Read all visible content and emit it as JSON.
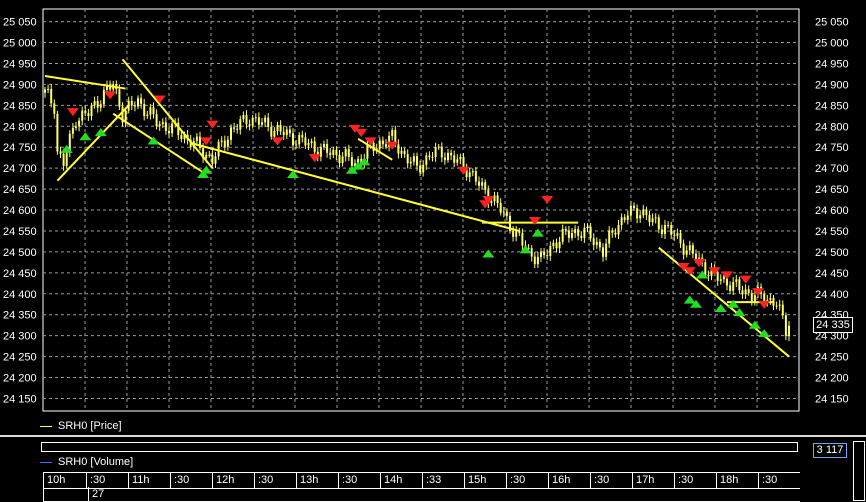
{
  "chart_data": {
    "type": "candlestick",
    "title": "",
    "price_series_name": "SRH0 [Price]",
    "volume_series_name": "SRH0 [Volume]",
    "y_ticks": [
      24150,
      24200,
      24250,
      24300,
      24350,
      24400,
      24450,
      24500,
      24550,
      24600,
      24650,
      24700,
      24750,
      24800,
      24850,
      24900,
      24950,
      25000,
      25050
    ],
    "y_tick_labels": [
      "24 150",
      "24 200",
      "24 250",
      "24 300",
      "24 350",
      "24 400",
      "24 450",
      "24 500",
      "24 550",
      "24 600",
      "24 650",
      "24 700",
      "24 750",
      "24 800",
      "24 850",
      "24 900",
      "24 950",
      "25 000",
      "25 050"
    ],
    "ylim": [
      24120,
      25080
    ],
    "grid": true,
    "last_price_label": "24 335",
    "volume_value_label": "3 117",
    "time_labels": [
      "10h",
      ":30",
      "11h",
      ":30",
      "12h",
      ":30",
      "13h",
      ":30",
      "14h",
      ":33",
      "15h",
      ":30",
      "16h",
      ":30",
      "17h",
      ":30",
      "18h",
      ":30"
    ],
    "volume_scale_label": "27",
    "price_anchors": [
      [
        0,
        24880
      ],
      [
        3,
        24850
      ],
      [
        4,
        24740
      ],
      [
        6,
        24710
      ],
      [
        10,
        24820
      ],
      [
        14,
        24830
      ],
      [
        18,
        24870
      ],
      [
        22,
        24900
      ],
      [
        25,
        24830
      ],
      [
        30,
        24860
      ],
      [
        36,
        24810
      ],
      [
        42,
        24790
      ],
      [
        48,
        24760
      ],
      [
        54,
        24720
      ],
      [
        60,
        24790
      ],
      [
        66,
        24820
      ],
      [
        72,
        24800
      ],
      [
        78,
        24780
      ],
      [
        84,
        24760
      ],
      [
        90,
        24740
      ],
      [
        96,
        24730
      ],
      [
        100,
        24710
      ],
      [
        104,
        24740
      ],
      [
        108,
        24760
      ],
      [
        112,
        24770
      ],
      [
        116,
        24730
      ],
      [
        120,
        24700
      ],
      [
        124,
        24730
      ],
      [
        128,
        24740
      ],
      [
        132,
        24720
      ],
      [
        136,
        24700
      ],
      [
        140,
        24660
      ],
      [
        144,
        24630
      ],
      [
        148,
        24590
      ],
      [
        152,
        24540
      ],
      [
        156,
        24500
      ],
      [
        160,
        24480
      ],
      [
        164,
        24520
      ],
      [
        170,
        24550
      ],
      [
        176,
        24540
      ],
      [
        180,
        24500
      ],
      [
        184,
        24560
      ],
      [
        188,
        24590
      ],
      [
        192,
        24600
      ],
      [
        196,
        24570
      ],
      [
        200,
        24560
      ],
      [
        204,
        24530
      ],
      [
        208,
        24500
      ],
      [
        212,
        24470
      ],
      [
        216,
        24440
      ],
      [
        220,
        24430
      ],
      [
        224,
        24410
      ],
      [
        228,
        24400
      ],
      [
        232,
        24390
      ],
      [
        236,
        24380
      ],
      [
        239,
        24310
      ],
      [
        240,
        24335
      ]
    ],
    "trendlines": [
      {
        "from": [
          0,
          24920
        ],
        "to": [
          26,
          24890
        ]
      },
      {
        "from": [
          4,
          24670
        ],
        "to": [
          27,
          24850
        ]
      },
      {
        "from": [
          25,
          24960
        ],
        "to": [
          54,
          24700
        ]
      },
      {
        "from": [
          22,
          24830
        ],
        "to": [
          51,
          24690
        ]
      },
      {
        "from": [
          47,
          24760
        ],
        "to": [
          153,
          24550
        ]
      },
      {
        "from": [
          101,
          24770
        ],
        "to": [
          112,
          24720
        ]
      },
      {
        "from": [
          141,
          24570
        ],
        "to": [
          172,
          24570
        ]
      },
      {
        "from": [
          198,
          24510
        ],
        "to": [
          240,
          24250
        ]
      },
      {
        "from": [
          220,
          24380
        ],
        "to": [
          235,
          24380
        ]
      }
    ],
    "buy_arrows": [
      [
        7,
        24770
      ],
      [
        13,
        24800
      ],
      [
        18,
        24810
      ],
      [
        35,
        24790
      ],
      [
        51,
        24710
      ],
      [
        52,
        24720
      ],
      [
        80,
        24710
      ],
      [
        99,
        24720
      ],
      [
        101,
        24730
      ],
      [
        103,
        24740
      ],
      [
        143,
        24520
      ],
      [
        155,
        24530
      ],
      [
        159,
        24570
      ],
      [
        208,
        24410
      ],
      [
        210,
        24400
      ],
      [
        212,
        24470
      ],
      [
        218,
        24390
      ],
      [
        222,
        24400
      ],
      [
        224,
        24380
      ],
      [
        229,
        24350
      ],
      [
        232,
        24330
      ]
    ],
    "sell_arrows": [
      [
        9,
        24810
      ],
      [
        21,
        24850
      ],
      [
        37,
        24840
      ],
      [
        52,
        24740
      ],
      [
        54,
        24780
      ],
      [
        75,
        24740
      ],
      [
        87,
        24700
      ],
      [
        100,
        24770
      ],
      [
        102,
        24760
      ],
      [
        105,
        24740
      ],
      [
        112,
        24730
      ],
      [
        135,
        24670
      ],
      [
        142,
        24590
      ],
      [
        143,
        24600
      ],
      [
        158,
        24550
      ],
      [
        162,
        24600
      ],
      [
        206,
        24440
      ],
      [
        208,
        24430
      ],
      [
        211,
        24450
      ],
      [
        216,
        24430
      ],
      [
        220,
        24420
      ],
      [
        226,
        24410
      ],
      [
        230,
        24380
      ],
      [
        232,
        24350
      ]
    ]
  }
}
